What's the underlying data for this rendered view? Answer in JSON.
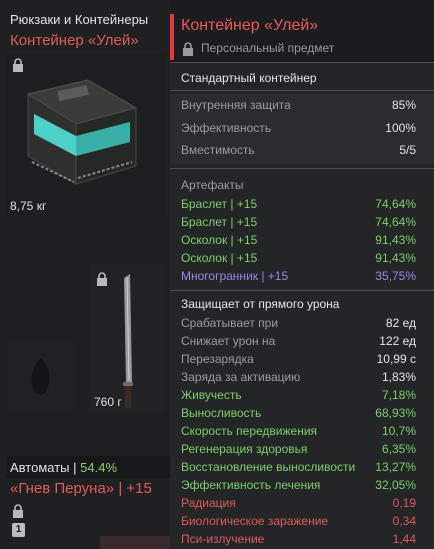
{
  "inventory": {
    "category": "Рюкзаки и Контейнеры",
    "item_name": "Контейнер «Улей»",
    "item_weight": "8,75 кг",
    "knife_weight": "760 г",
    "weapons_category": "Автоматы",
    "weapons_percent": "54.4%",
    "weapon_name": "«Гнев Перуна» | +15",
    "badge": "1"
  },
  "tooltip": {
    "title": "Контейнер «Улей»",
    "subtitle": "Персональный предмет",
    "type": "Стандартный контейнер",
    "stats": [
      {
        "label": "Внутренняя защита",
        "value": "85%"
      },
      {
        "label": "Эффективность",
        "value": "100%"
      },
      {
        "label": "Вместимость",
        "value": "5/5"
      }
    ],
    "artifacts_header": "Артефакты",
    "artifacts": [
      {
        "label": "Браслет | +15",
        "value": "74,64%"
      },
      {
        "label": "Браслет | +15",
        "value": "74,64%"
      },
      {
        "label": "Осколок | +15",
        "value": "91,43%"
      },
      {
        "label": "Осколок | +15",
        "value": "91,43%"
      },
      {
        "label": "Многогранник | +15",
        "value": "35,75%"
      }
    ],
    "protection_header": "Защищает от прямого урона",
    "protection": [
      {
        "label": "Срабатывает при",
        "value": "82 ед"
      },
      {
        "label": "Снижает урон на",
        "value": "122 ед"
      },
      {
        "label": "Перезарядка",
        "value": "10,99 с"
      },
      {
        "label": "Заряда за активацию",
        "value": "1,83%"
      }
    ],
    "effects": [
      {
        "label": "Живучесть",
        "value": "7,18%"
      },
      {
        "label": "Выносливость",
        "value": "68,93%"
      },
      {
        "label": "Скорость передвижения",
        "value": "10,7%"
      },
      {
        "label": "Регенерация здоровья",
        "value": "6,35%"
      },
      {
        "label": "Восстановление выносливости",
        "value": "13,27%"
      },
      {
        "label": "Эффективность лечения",
        "value": "32,05%"
      }
    ],
    "negatives": [
      {
        "label": "Радиация",
        "value": "0,19"
      },
      {
        "label": "Биологическое заражение",
        "value": "0,34"
      },
      {
        "label": "Пси-излучение",
        "value": "1,44"
      }
    ]
  },
  "colors": {
    "accent_red": "#e03c3c",
    "positive_green": "#7ed06a",
    "rare_purple": "#9a86e8",
    "negative_red": "#e25a5a"
  }
}
